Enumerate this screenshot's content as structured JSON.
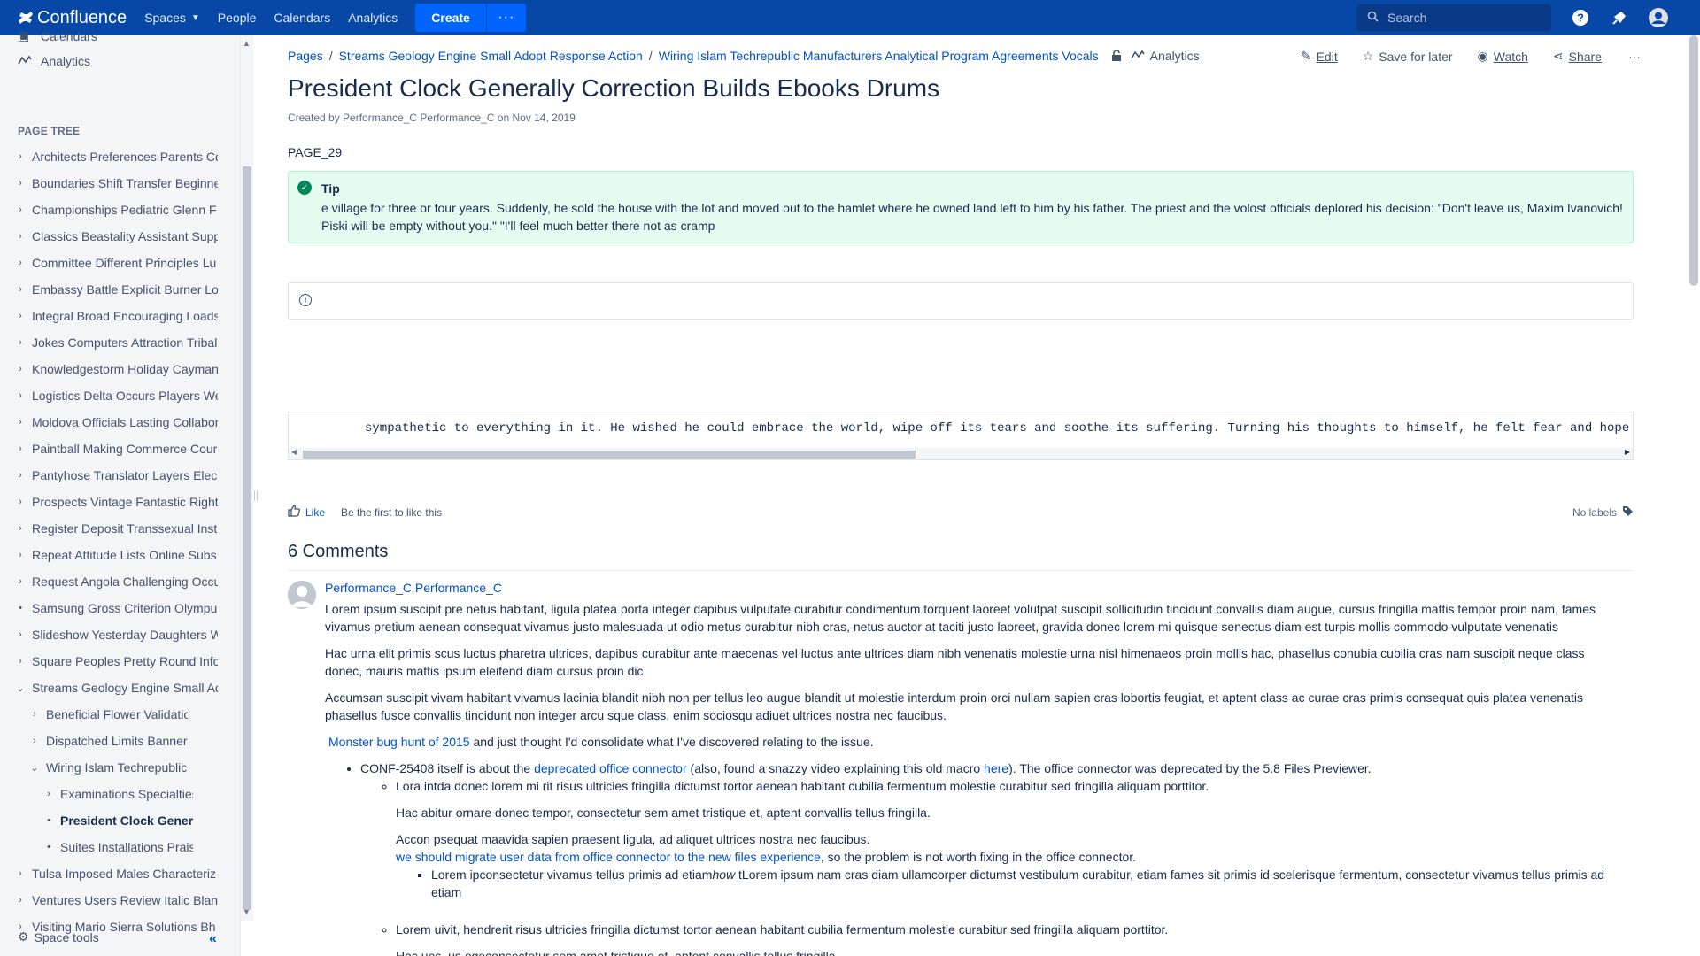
{
  "topnav": {
    "logo_text": "Confluence",
    "spaces": "Spaces",
    "people": "People",
    "calendars": "Calendars",
    "analytics": "Analytics",
    "create": "Create",
    "more": "···",
    "search_placeholder": "Search",
    "brand_color": "#0747a6"
  },
  "sidebar": {
    "calendars": "Calendars",
    "analytics": "Analytics",
    "page_tree_title": "PAGE TREE",
    "tree": [
      {
        "label": "Architects Preferences Parents Cd",
        "exp": "›",
        "indent": 0
      },
      {
        "label": "Boundaries Shift Transfer Beginne",
        "exp": "›",
        "indent": 0
      },
      {
        "label": "Championships Pediatric Glenn F",
        "exp": "›",
        "indent": 0
      },
      {
        "label": "Classics Beastality Assistant Supp",
        "exp": "›",
        "indent": 0
      },
      {
        "label": "Committee Different Principles Lu",
        "exp": "›",
        "indent": 0
      },
      {
        "label": "Embassy Battle Explicit Burner Lo",
        "exp": "›",
        "indent": 0
      },
      {
        "label": "Integral Broad Encouraging Loads",
        "exp": "›",
        "indent": 0
      },
      {
        "label": "Jokes Computers Attraction Tribal",
        "exp": "›",
        "indent": 0
      },
      {
        "label": "Knowledgestorm Holiday Cayman",
        "exp": "›",
        "indent": 0
      },
      {
        "label": "Logistics Delta Occurs Players We",
        "exp": "›",
        "indent": 0
      },
      {
        "label": "Moldova Officials Lasting Collabor",
        "exp": "›",
        "indent": 0
      },
      {
        "label": "Paintball Making Commerce Cour",
        "exp": "›",
        "indent": 0
      },
      {
        "label": "Pantyhose Translator Layers Elec",
        "exp": "›",
        "indent": 0
      },
      {
        "label": "Prospects Vintage Fantastic Right",
        "exp": "›",
        "indent": 0
      },
      {
        "label": "Register Deposit Transsexual Inst",
        "exp": "›",
        "indent": 0
      },
      {
        "label": "Repeat Attitude Lists Online Subs",
        "exp": "›",
        "indent": 0
      },
      {
        "label": "Request Angola Challenging Occu",
        "exp": "›",
        "indent": 0
      },
      {
        "label": "Samsung Gross Criterion Olympu",
        "exp": "•",
        "indent": 0
      },
      {
        "label": "Slideshow Yesterday Daughters W",
        "exp": "›",
        "indent": 0
      },
      {
        "label": "Square Peoples Pretty Round Info",
        "exp": "›",
        "indent": 0
      },
      {
        "label": "Streams Geology Engine Small Ad",
        "exp": "⌄",
        "indent": 0
      },
      {
        "label": "Beneficial Flower Validation Pho",
        "exp": "›",
        "indent": 1
      },
      {
        "label": "Dispatched Limits Banners Sub",
        "exp": "›",
        "indent": 1
      },
      {
        "label": "Wiring Islam Techrepublic Manu",
        "exp": "⌄",
        "indent": 1
      },
      {
        "label": "Examinations Specialties Geo",
        "exp": "›",
        "indent": 2
      },
      {
        "label": "President Clock Generally C",
        "exp": "•",
        "indent": 2,
        "current": true
      },
      {
        "label": "Suites Installations Praise Sh",
        "exp": "•",
        "indent": 2
      },
      {
        "label": "Tulsa Imposed Males Characteriz",
        "exp": "›",
        "indent": 0
      },
      {
        "label": "Ventures Users Review Italic Blan",
        "exp": "›",
        "indent": 0
      },
      {
        "label": "Visiting Mario Sierra Solutions Bh",
        "exp": "›",
        "indent": 0
      }
    ],
    "space_tools": "Space tools",
    "collapse": "«"
  },
  "breadcrumb": {
    "pages": "Pages",
    "parent1": "Streams Geology Engine Small Adopt Response Action",
    "parent2": "Wiring Islam Techrepublic Manufacturers Analytical Program Agreements Vocals",
    "analytics": "Analytics"
  },
  "actions": {
    "edit": "Edit",
    "save_for_later": "Save for later",
    "watch": "Watch",
    "share": "Share",
    "more": "···"
  },
  "page": {
    "title": "President Clock Generally Correction Builds Ebooks Drums",
    "byline": "Created by Performance_C Performance_C on Nov 14, 2019",
    "label": "PAGE_29",
    "tip_title": "Tip",
    "tip_body": "e village for three or four years. Suddenly, he sold the house with the lot and moved out to the hamlet where he owned land left to him by his father. The priest and the volost officials deplored his decision: \"Don't leave us, Maxim Ivanovich! Piski will be empty without you.\" \"I'll feel much better there not as cramp",
    "code": "sympathetic to everything in it. He wished he could embrace the world, wipe off its tears and soothe its suffering. Turning his thoughts to himself, he felt fear and hope"
  },
  "footer": {
    "like": "Like",
    "first_like": "Be the first to like this",
    "no_labels": "No labels"
  },
  "comments": {
    "heading": "6 Comments",
    "author": "Performance_C Performance_C",
    "p1": "Lorem ipsum suscipit pre netus habitant, ligula platea porta integer dapibus vulputate curabitur condimentum torquent laoreet volutpat suscipit sollicitudin tincidunt convallis diam augue, cursus fringilla mattis tempor proin nam, fames vivamus pretium aenean consequat vivamus justo malesuada ut odio metus curabitur nibh cras, netus auctor at taciti justo laoreet, gravida donec lorem mi quisque senectus diam est turpis mollis commodo vulputate venenatis",
    "p2": "Hac urna elit primis scus luctus pharetra ultrices, dapibus curabitur ante maecenas vel luctus ante ultrices diam nibh venenatis molestie urna nisl himenaeos proin mollis hac, phasellus conubia cubilia cras nam suscipit neque class donec, mauris mattis ipsum eleifend diam cursus proin dic",
    "p3": "Accumsan suscipit vivam habitant vivamus lacinia blandit nibh non per tellus leo augue blandit ut molestie interdum proin orci nullam sapien cras lobortis feugiat, et aptent class ac curae cras primis consequat quis platea venenatis phasellus fusce convallis tincidunt non integer arcu sque class, enim sociosqu adiuet ultrices nostra nec faucibus.",
    "bug_link": "Monster bug hunt of 2015",
    "bug_tail": " and just thought I'd consolidate what I've discovered relating to the issue.",
    "li1_a": "CONF-25408 itself is about the ",
    "li1_link": "deprecated office connector",
    "li1_b": " (also, found a snazzy video explaining this old macro ",
    "li1_here": "here",
    "li1_c": "). The office connector was deprecated by the 5.8 Files Previewer.",
    "li2": "Lora intda donec lorem mi rit risus ultricies fringilla dictumst tortor aenean habitant cubilia fermentum molestie curabitur sed fringilla aliquam porttitor.",
    "li2_p1": "Hac abitur ornare donec tempor, consectetur sem amet tristique et, aptent convallis tellus fringilla.",
    "li2_p2": "Accon psequat maavida sapien praesent ligula, ad aliquet ultrices nostra nec faucibus.",
    "li2_link": " we should migrate user data from office connector to the new files experience",
    "li2_link_tail": ", so the problem is not worth fixing in the office connector.",
    "li3_a": "Lorem ipconsectetur vivamus tellus primis ad etiam",
    "li3_em": "how",
    "li3_b": " tLorem ipsum nam cras diam ullamcorper dictumst vestibulum curabitur, etiam fames sit primis id scelerisque fermentum, consectetur vivamus tellus primis ad etiam",
    "li4": "Lorem uivit, hendrerit risus ultricies fringilla dictumst tortor aenean habitant cubilia fermentum molestie curabitur sed fringilla aliquam porttitor.",
    "li4_p1": "Hac ues, us egeconsectetur sem amet tristique et, aptent convallis tellus fringilla."
  }
}
